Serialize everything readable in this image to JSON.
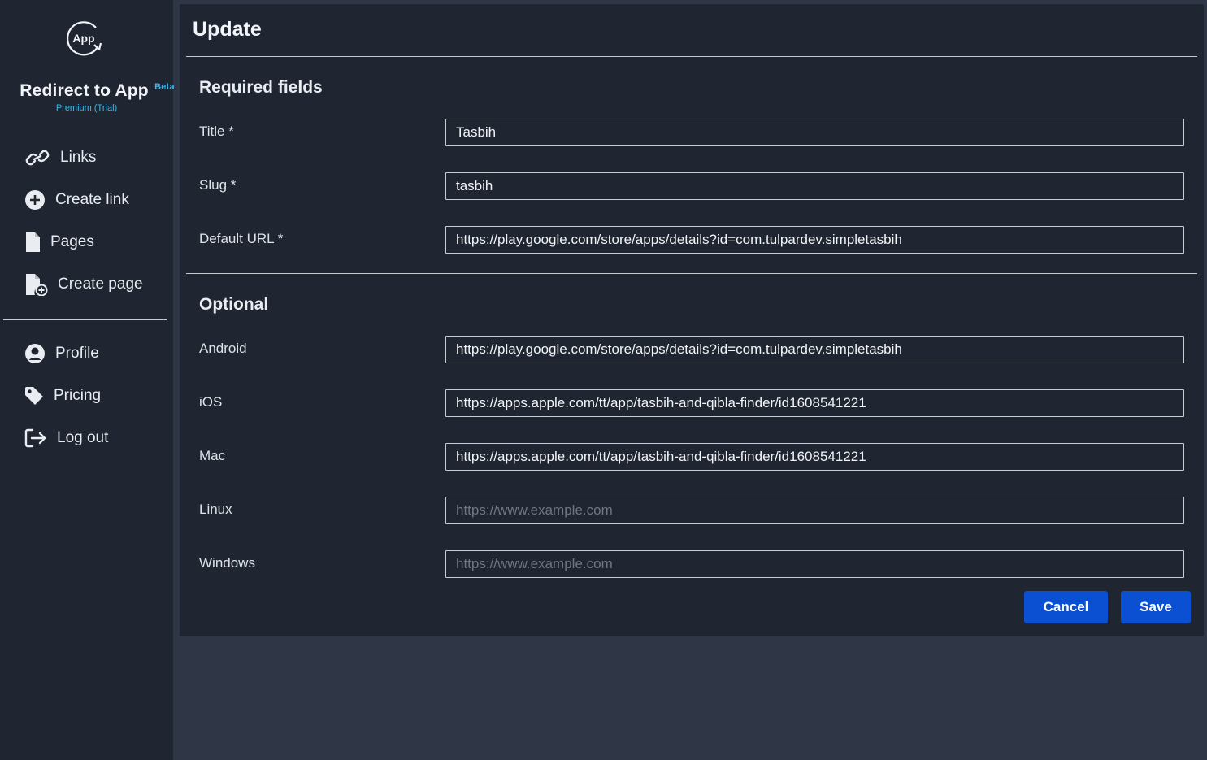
{
  "brand": {
    "logo_text": "App",
    "title": "Redirect to App",
    "badge": "Beta",
    "subtitle": "Premium (Trial)"
  },
  "sidebar": {
    "items": [
      {
        "label": "Links",
        "icon": "link-icon"
      },
      {
        "label": "Create link",
        "icon": "plus-circle-icon"
      },
      {
        "label": "Pages",
        "icon": "file-icon"
      },
      {
        "label": "Create page",
        "icon": "file-plus-icon"
      },
      {
        "label": "Profile",
        "icon": "user-circle-icon"
      },
      {
        "label": "Pricing",
        "icon": "tag-icon"
      },
      {
        "label": "Log out",
        "icon": "logout-icon"
      }
    ]
  },
  "form": {
    "title": "Update",
    "required_section": "Required fields",
    "optional_section": "Optional",
    "fields": {
      "title": {
        "label": "Title *",
        "value": "Tasbih",
        "placeholder": ""
      },
      "slug": {
        "label": "Slug *",
        "value": "tasbih",
        "placeholder": ""
      },
      "default_url": {
        "label": "Default URL *",
        "value": "https://play.google.com/store/apps/details?id=com.tulpardev.simpletasbih",
        "placeholder": ""
      },
      "android": {
        "label": "Android",
        "value": "https://play.google.com/store/apps/details?id=com.tulpardev.simpletasbih",
        "placeholder": ""
      },
      "ios": {
        "label": "iOS",
        "value": "https://apps.apple.com/tt/app/tasbih-and-qibla-finder/id1608541221",
        "placeholder": ""
      },
      "mac": {
        "label": "Mac",
        "value": "https://apps.apple.com/tt/app/tasbih-and-qibla-finder/id1608541221",
        "placeholder": ""
      },
      "linux": {
        "label": "Linux",
        "value": "",
        "placeholder": "https://www.example.com"
      },
      "windows": {
        "label": "Windows",
        "value": "",
        "placeholder": "https://www.example.com"
      }
    },
    "cancel_label": "Cancel",
    "save_label": "Save"
  },
  "colors": {
    "accent": "#0b4fd3",
    "brand_accent": "#3fb6e8",
    "sidebar_bg": "#1f2531",
    "page_bg": "#2f3746"
  }
}
